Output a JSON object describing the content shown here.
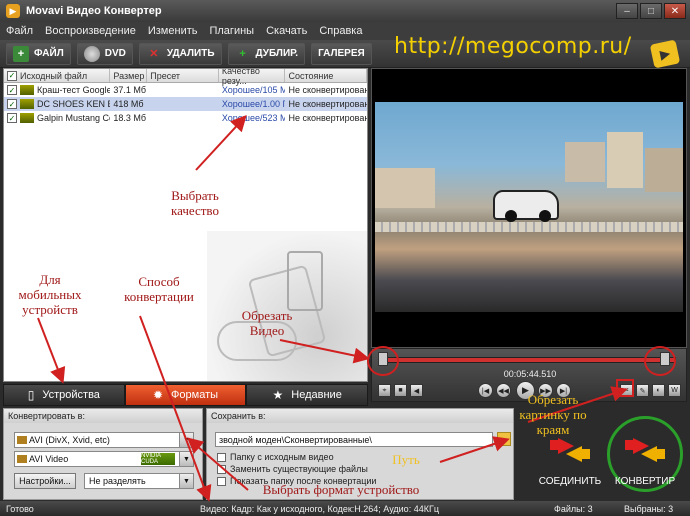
{
  "window": {
    "title": "Movavi Видео Конвертер",
    "min": "–",
    "max": "□",
    "close": "✕"
  },
  "menu": [
    "Файл",
    "Воспроизведение",
    "Изменить",
    "Плагины",
    "Скачать",
    "Справка"
  ],
  "toolbar": {
    "file": "ФАЙЛ",
    "dvd": "DVD",
    "delete": "УДАЛИТЬ",
    "duplicate": "ДУБЛИР.",
    "gallery": "ГАЛЕРЕЯ"
  },
  "watermark": "http://megocomp.ru/",
  "table": {
    "headers": [
      "Исходный файл",
      "Размер",
      "Пресет",
      "Качество резу...",
      "Состояние"
    ],
    "rows": [
      {
        "name": "Краш-тест Google...",
        "size": "37.1 Мб",
        "preset": "",
        "quality": "Хорошее/105 Мб",
        "status": "Не сконвертирован"
      },
      {
        "name": "DC SHOES KEN BL...",
        "size": "418 Мб",
        "preset": "",
        "quality": "Хорошее/1.00 ГБ",
        "status": "Не сконвертирован"
      },
      {
        "name": "Galpin Mustang Co...",
        "size": "18.3 Мб",
        "preset": "",
        "quality": "Хорошее/523 Мб",
        "status": "Не сконвертирован"
      }
    ]
  },
  "tabs": [
    "Устройства",
    "Форматы",
    "Недавние"
  ],
  "convert": {
    "label": "Конвертировать в:",
    "format": "AVI (DivX, Xvid, etc)",
    "codec": "AVI Video",
    "cuda": "NVIDIA CUDA",
    "settings": "Настройки...",
    "split": "Не разделять"
  },
  "save": {
    "label": "Сохранить в:",
    "path": "зводной моден\\Сконвертированные\\",
    "opt1": "Папку с исходным видео",
    "opt2": "Заменить существующие файлы",
    "opt3": "Показать папку после конвертации"
  },
  "buttons": {
    "join": "СОЕДИНИТЬ",
    "convert": "КОНВЕРТИР"
  },
  "player": {
    "time": "00:05:44.510"
  },
  "status": {
    "ready": "Готово",
    "video": "Видео: Кадр: Как у исходного, Кодек:H.264; Аудио: 44КГц",
    "files": "Файлы: 3",
    "selected": "Выбраны: 3"
  },
  "annotations": {
    "quality": "Выбрать\nкачество",
    "mobile": "Для\nмобильных\nустройств",
    "method": "Способ\nконвертации",
    "trim": "Обрезать\nВидео",
    "crop": "Обрезать\nкартинку по\nкраям",
    "path": "Путь",
    "format": "Выбрать формат устройство"
  }
}
